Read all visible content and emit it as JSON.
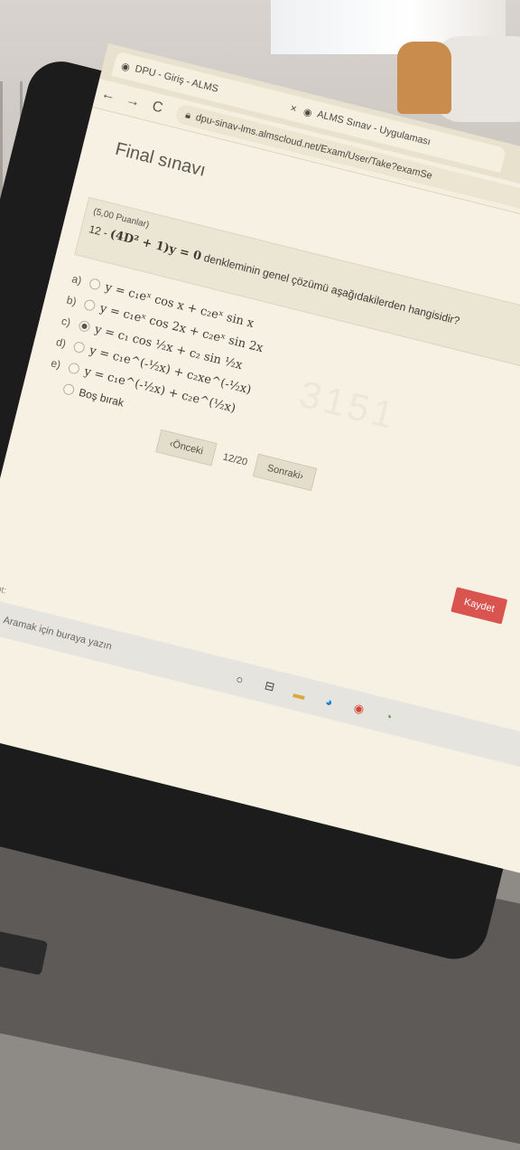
{
  "browser": {
    "tabs": [
      {
        "title": "DPU - Giriş - ALMS",
        "close": "×"
      },
      {
        "title": "ALMS Sınav - Uygulaması"
      }
    ],
    "url": "dpu-sinav-lms.almscloud.net/Exam/User/Take?examSe"
  },
  "page": {
    "title": "Final sınavı",
    "question": {
      "points": "(5,00 Puanlar)",
      "number": "12 -",
      "equation": "(4D² + 1)y = 0",
      "prompt": "denkleminin genel çözümü aşağıdakilerden hangisidir?"
    },
    "options": [
      {
        "letter": "a)",
        "text": "y = c₁eˣ cos x + c₂eˣ sin x",
        "selected": false
      },
      {
        "letter": "b)",
        "text": "y = c₁eˣ cos 2x + c₂eˣ sin 2x",
        "selected": false
      },
      {
        "letter": "c)",
        "text": "y = c₁ cos ½x + c₂ sin ½x",
        "selected": true
      },
      {
        "letter": "d)",
        "text": "y = c₁e^(-½x) + c₂xe^(-½x)",
        "selected": false
      },
      {
        "letter": "e)",
        "text": "y = c₁e^(-½x) + c₂e^(½x)",
        "selected": false
      }
    ],
    "leave_blank": "Boş bırak",
    "pager": {
      "prev": "Önceki",
      "time": "12/20",
      "next": "Sonraki"
    },
    "submit": "Kaydet",
    "watermark": "3151"
  },
  "os": {
    "js_hint": "avascript:",
    "search_placeholder": "Aramak için buraya yazın"
  },
  "icons": {
    "back": "back-arrow-icon",
    "forward": "forward-arrow-icon",
    "reload": "reload-icon",
    "lock": "lock-icon"
  }
}
